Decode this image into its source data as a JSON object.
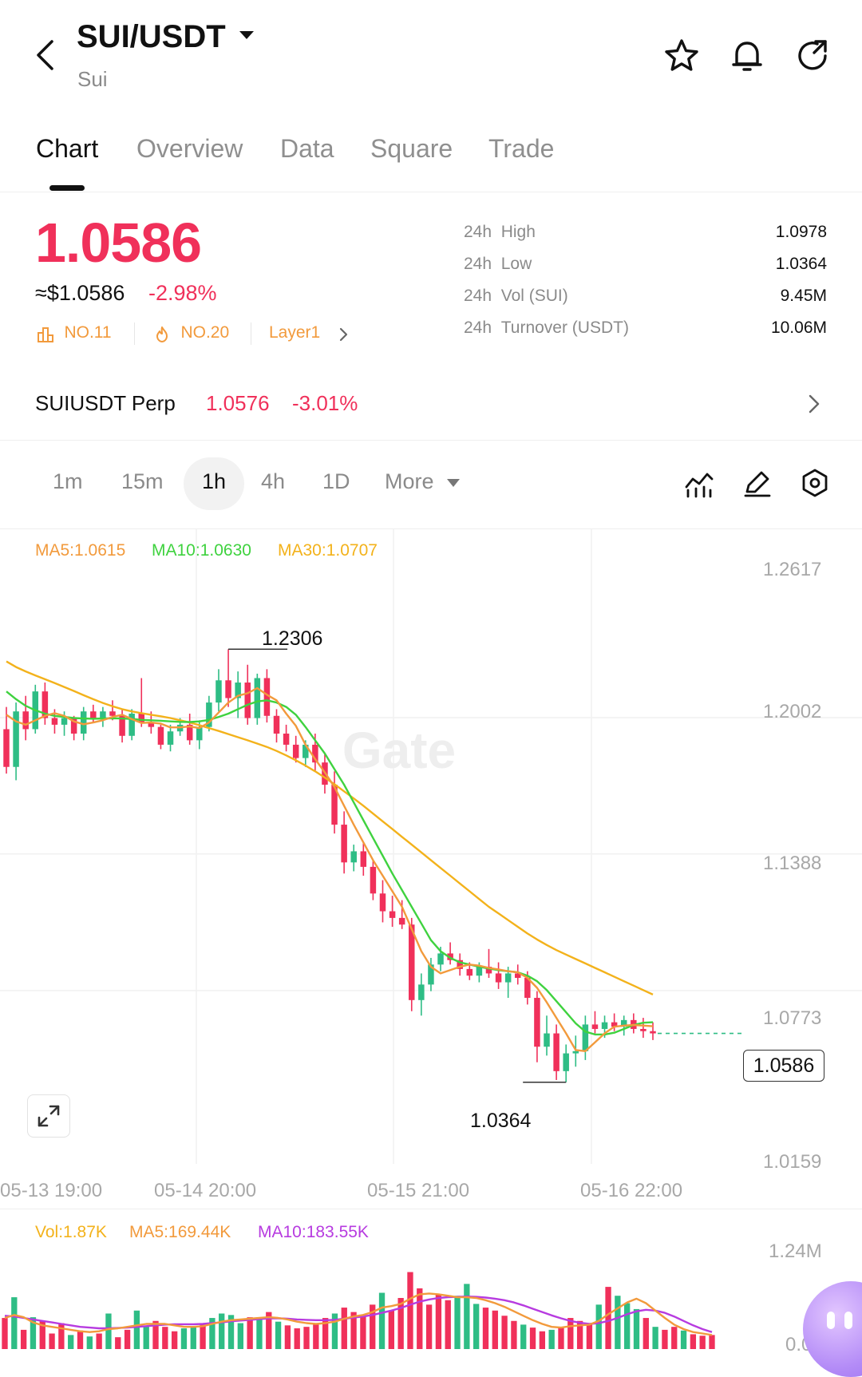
{
  "header": {
    "pair": "SUI/USDT",
    "subtitle": "Sui"
  },
  "tabs": [
    "Chart",
    "Overview",
    "Data",
    "Square",
    "Trade"
  ],
  "price": {
    "last": "1.0586",
    "usd": "≈$1.0586",
    "change": "-2.98%"
  },
  "badges": {
    "rank1": "NO.11",
    "rank2": "NO.20",
    "sector": "Layer1"
  },
  "stats": [
    {
      "label": "24h",
      "name": "High",
      "value": "1.0978"
    },
    {
      "label": "24h",
      "name": "Low",
      "value": "1.0364"
    },
    {
      "label": "24h",
      "name": "Vol (SUI)",
      "value": "9.45M"
    },
    {
      "label": "24h",
      "name": "Turnover (USDT)",
      "value": "10.06M"
    }
  ],
  "perp": {
    "name": "SUIUSDT Perp",
    "price": "1.0576",
    "change": "-3.01%"
  },
  "timeframes": [
    "1m",
    "15m",
    "1h",
    "4h",
    "1D",
    "More"
  ],
  "active_timeframe": "1h",
  "ma_legend": {
    "ma5": "MA5:1.0615",
    "ma10": "MA10:1.0630",
    "ma30": "MA30:1.0707"
  },
  "vol_legend": {
    "vol": "Vol:1.87K",
    "ma5": "MA5:169.44K",
    "ma10": "MA10:183.55K"
  },
  "watermark": "Gate",
  "colors": {
    "up": "#2ebd85",
    "down": "#f0305a",
    "ma5": "#f29a3c",
    "ma10": "#3fd23f",
    "ma30": "#f3b21b",
    "vol_ma10": "#b73be0"
  },
  "chart_data": {
    "type": "candlestick",
    "y_ticks": [
      "1.2617",
      "1.2002",
      "1.1388",
      "1.0773",
      "1.0159"
    ],
    "x_ticks": [
      "05-13 19:00",
      "05-14 20:00",
      "05-15 21:00",
      "05-16 22:00"
    ],
    "current_price": "1.0586",
    "high_label": "1.2306",
    "low_label": "1.0364",
    "ylim": [
      1.0159,
      1.2617
    ],
    "candles": [
      [
        1.195,
        1.205,
        1.175,
        1.178
      ],
      [
        1.178,
        1.207,
        1.172,
        1.203
      ],
      [
        1.203,
        1.21,
        1.19,
        1.195
      ],
      [
        1.195,
        1.215,
        1.193,
        1.212
      ],
      [
        1.212,
        1.216,
        1.197,
        1.2
      ],
      [
        1.2,
        1.204,
        1.193,
        1.197
      ],
      [
        1.197,
        1.203,
        1.192,
        1.2
      ],
      [
        1.2,
        1.201,
        1.19,
        1.193
      ],
      [
        1.193,
        1.205,
        1.19,
        1.203
      ],
      [
        1.203,
        1.206,
        1.198,
        1.2
      ],
      [
        1.2,
        1.205,
        1.196,
        1.203
      ],
      [
        1.203,
        1.208,
        1.199,
        1.201
      ],
      [
        1.201,
        1.204,
        1.189,
        1.192
      ],
      [
        1.192,
        1.204,
        1.19,
        1.202
      ],
      [
        1.202,
        1.218,
        1.196,
        1.198
      ],
      [
        1.198,
        1.203,
        1.193,
        1.196
      ],
      [
        1.196,
        1.197,
        1.186,
        1.188
      ],
      [
        1.188,
        1.197,
        1.185,
        1.194
      ],
      [
        1.194,
        1.2,
        1.192,
        1.197
      ],
      [
        1.197,
        1.202,
        1.188,
        1.19
      ],
      [
        1.19,
        1.199,
        1.186,
        1.196
      ],
      [
        1.196,
        1.21,
        1.194,
        1.207
      ],
      [
        1.207,
        1.222,
        1.203,
        1.217
      ],
      [
        1.217,
        1.231,
        1.205,
        1.209
      ],
      [
        1.209,
        1.221,
        1.2,
        1.216
      ],
      [
        1.216,
        1.224,
        1.197,
        1.2
      ],
      [
        1.2,
        1.22,
        1.197,
        1.218
      ],
      [
        1.218,
        1.222,
        1.198,
        1.201
      ],
      [
        1.201,
        1.204,
        1.189,
        1.193
      ],
      [
        1.193,
        1.197,
        1.185,
        1.188
      ],
      [
        1.188,
        1.192,
        1.18,
        1.182
      ],
      [
        1.182,
        1.19,
        1.178,
        1.188
      ],
      [
        1.188,
        1.193,
        1.176,
        1.18
      ],
      [
        1.18,
        1.184,
        1.166,
        1.17
      ],
      [
        1.17,
        1.176,
        1.148,
        1.152
      ],
      [
        1.152,
        1.158,
        1.13,
        1.135
      ],
      [
        1.135,
        1.143,
        1.131,
        1.14
      ],
      [
        1.14,
        1.144,
        1.129,
        1.133
      ],
      [
        1.133,
        1.136,
        1.118,
        1.121
      ],
      [
        1.121,
        1.127,
        1.108,
        1.113
      ],
      [
        1.113,
        1.12,
        1.106,
        1.11
      ],
      [
        1.11,
        1.118,
        1.105,
        1.107
      ],
      [
        1.107,
        1.11,
        1.068,
        1.073
      ],
      [
        1.073,
        1.085,
        1.066,
        1.08
      ],
      [
        1.08,
        1.092,
        1.077,
        1.089
      ],
      [
        1.089,
        1.097,
        1.086,
        1.094
      ],
      [
        1.094,
        1.099,
        1.089,
        1.091
      ],
      [
        1.091,
        1.094,
        1.084,
        1.087
      ],
      [
        1.087,
        1.09,
        1.082,
        1.084
      ],
      [
        1.084,
        1.09,
        1.081,
        1.088
      ],
      [
        1.088,
        1.096,
        1.083,
        1.085
      ],
      [
        1.085,
        1.09,
        1.078,
        1.081
      ],
      [
        1.081,
        1.088,
        1.074,
        1.085
      ],
      [
        1.085,
        1.089,
        1.08,
        1.083
      ],
      [
        1.083,
        1.086,
        1.071,
        1.074
      ],
      [
        1.074,
        1.077,
        1.045,
        1.052
      ],
      [
        1.052,
        1.066,
        1.048,
        1.058
      ],
      [
        1.058,
        1.062,
        1.037,
        1.041
      ],
      [
        1.041,
        1.053,
        1.036,
        1.049
      ],
      [
        1.049,
        1.057,
        1.043,
        1.05
      ],
      [
        1.05,
        1.066,
        1.046,
        1.062
      ],
      [
        1.062,
        1.068,
        1.058,
        1.06
      ],
      [
        1.06,
        1.066,
        1.056,
        1.063
      ],
      [
        1.063,
        1.067,
        1.059,
        1.061
      ],
      [
        1.061,
        1.066,
        1.057,
        1.064
      ],
      [
        1.064,
        1.067,
        1.058,
        1.06
      ],
      [
        1.06,
        1.065,
        1.056,
        1.059
      ],
      [
        1.059,
        1.063,
        1.055,
        1.058
      ]
    ],
    "ma5": [
      1.2015,
      1.1985,
      1.197,
      1.199,
      1.201,
      1.2022,
      1.201,
      1.1985,
      1.1972,
      1.198,
      1.199,
      1.2005,
      1.2015,
      1.1995,
      1.1978,
      1.198,
      1.1975,
      1.1958,
      1.1958,
      1.1962,
      1.1955,
      1.198,
      1.2025,
      1.207,
      1.21,
      1.2112,
      1.2135,
      1.2105,
      1.208,
      1.202,
      1.1965,
      1.188,
      1.1815,
      1.1755,
      1.169,
      1.1605,
      1.152,
      1.144,
      1.136,
      1.129,
      1.122,
      1.115,
      1.105,
      1.095,
      1.088,
      1.085,
      1.0865,
      1.088,
      1.089,
      1.0885,
      1.0875,
      1.0868,
      1.086,
      1.0855,
      1.083,
      1.0785,
      1.072,
      1.065,
      1.058,
      1.0505,
      1.05,
      1.054,
      1.058,
      1.061,
      1.0615,
      1.0618,
      1.0615,
      1.0612
    ],
    "ma10": [
      1.212,
      1.2085,
      1.2055,
      1.2035,
      1.202,
      1.201,
      1.2005,
      1.2,
      1.1998,
      1.1997,
      1.1998,
      1.1999,
      1.1998,
      1.1996,
      1.1992,
      1.199,
      1.1988,
      1.1985,
      1.1983,
      1.1982,
      1.1985,
      1.1992,
      1.2005,
      1.202,
      1.204,
      1.206,
      1.2075,
      1.208,
      1.207,
      1.205,
      1.2015,
      1.196,
      1.19,
      1.184,
      1.177,
      1.17,
      1.162,
      1.154,
      1.146,
      1.138,
      1.13,
      1.1225,
      1.115,
      1.1075,
      1.1,
      1.095,
      1.092,
      1.09,
      1.089,
      1.088,
      1.0872,
      1.0865,
      1.086,
      1.0855,
      1.084,
      1.0815,
      1.0775,
      1.0725,
      1.0675,
      1.0625,
      1.0588,
      1.0575,
      1.0575,
      1.0583,
      1.06,
      1.0618,
      1.0628,
      1.063
    ],
    "ma30": [
      1.2255,
      1.223,
      1.221,
      1.2192,
      1.2175,
      1.2158,
      1.214,
      1.2122,
      1.2103,
      1.2085,
      1.2068,
      1.2053,
      1.204,
      1.203,
      1.2022,
      1.2015,
      1.2008,
      1.2,
      1.199,
      1.198,
      1.1968,
      1.1955,
      1.1942,
      1.1928,
      1.1914,
      1.19,
      1.1885,
      1.187,
      1.1852,
      1.1832,
      1.181,
      1.1786,
      1.176,
      1.1732,
      1.1702,
      1.167,
      1.1638,
      1.1605,
      1.157,
      1.1535,
      1.15,
      1.1465,
      1.143,
      1.1395,
      1.136,
      1.1325,
      1.129,
      1.1255,
      1.122,
      1.1185,
      1.115,
      1.112,
      1.109,
      1.106,
      1.103,
      1.1003,
      1.0978,
      1.0955,
      1.0935,
      1.0915,
      1.0895,
      1.0875,
      1.0855,
      1.0835,
      1.0815,
      1.0795,
      1.0775,
      1.0755
    ],
    "volume": {
      "y_ticks": [
        "1.24M",
        "0.00"
      ],
      "ylim": [
        0,
        1240000
      ],
      "bars": [
        420000,
        700000,
        260000,
        430000,
        380000,
        210000,
        350000,
        190000,
        250000,
        170000,
        210000,
        480000,
        160000,
        260000,
        520000,
        310000,
        380000,
        300000,
        240000,
        280000,
        300000,
        330000,
        420000,
        480000,
        460000,
        350000,
        430000,
        420000,
        500000,
        370000,
        320000,
        280000,
        300000,
        330000,
        420000,
        480000,
        560000,
        500000,
        440000,
        600000,
        760000,
        520000,
        690000,
        1040000,
        820000,
        600000,
        740000,
        660000,
        720000,
        880000,
        610000,
        560000,
        520000,
        450000,
        380000,
        330000,
        290000,
        240000,
        260000,
        300000,
        420000,
        380000,
        340000,
        600000,
        840000,
        720000,
        620000,
        540000,
        420000,
        300000,
        260000,
        300000,
        250000,
        200000,
        180000,
        190000
      ],
      "ma5": [
        420000,
        460000,
        430000,
        360000,
        320000,
        300000,
        280000,
        260000,
        240000,
        230000,
        240000,
        270000,
        280000,
        300000,
        320000,
        340000,
        340000,
        340000,
        320000,
        300000,
        300000,
        310000,
        340000,
        370000,
        390000,
        400000,
        410000,
        420000,
        430000,
        420000,
        400000,
        370000,
        350000,
        340000,
        350000,
        370000,
        410000,
        440000,
        460000,
        500000,
        560000,
        580000,
        610000,
        680000,
        740000,
        750000,
        740000,
        720000,
        700000,
        700000,
        690000,
        660000,
        620000,
        570000,
        510000,
        450000,
        390000,
        340000,
        300000,
        290000,
        310000,
        320000,
        330000,
        380000,
        470000,
        550000,
        630000,
        680000,
        620000,
        520000,
        420000,
        330000,
        270000,
        230000,
        210000,
        190000
      ],
      "ma10": [
        450000,
        440000,
        420000,
        400000,
        380000,
        360000,
        340000,
        320000,
        300000,
        290000,
        280000,
        280000,
        285000,
        290000,
        300000,
        310000,
        320000,
        330000,
        335000,
        335000,
        335000,
        340000,
        350000,
        360000,
        375000,
        385000,
        395000,
        405000,
        415000,
        415000,
        410000,
        400000,
        395000,
        390000,
        390000,
        395000,
        410000,
        425000,
        440000,
        460000,
        490000,
        520000,
        555000,
        600000,
        640000,
        670000,
        690000,
        700000,
        705000,
        710000,
        705000,
        695000,
        680000,
        660000,
        630000,
        590000,
        545000,
        500000,
        455000,
        415000,
        380000,
        355000,
        340000,
        350000,
        380000,
        420000,
        470000,
        510000,
        530000,
        520000,
        490000,
        440000,
        380000,
        320000,
        270000,
        230000
      ]
    }
  }
}
